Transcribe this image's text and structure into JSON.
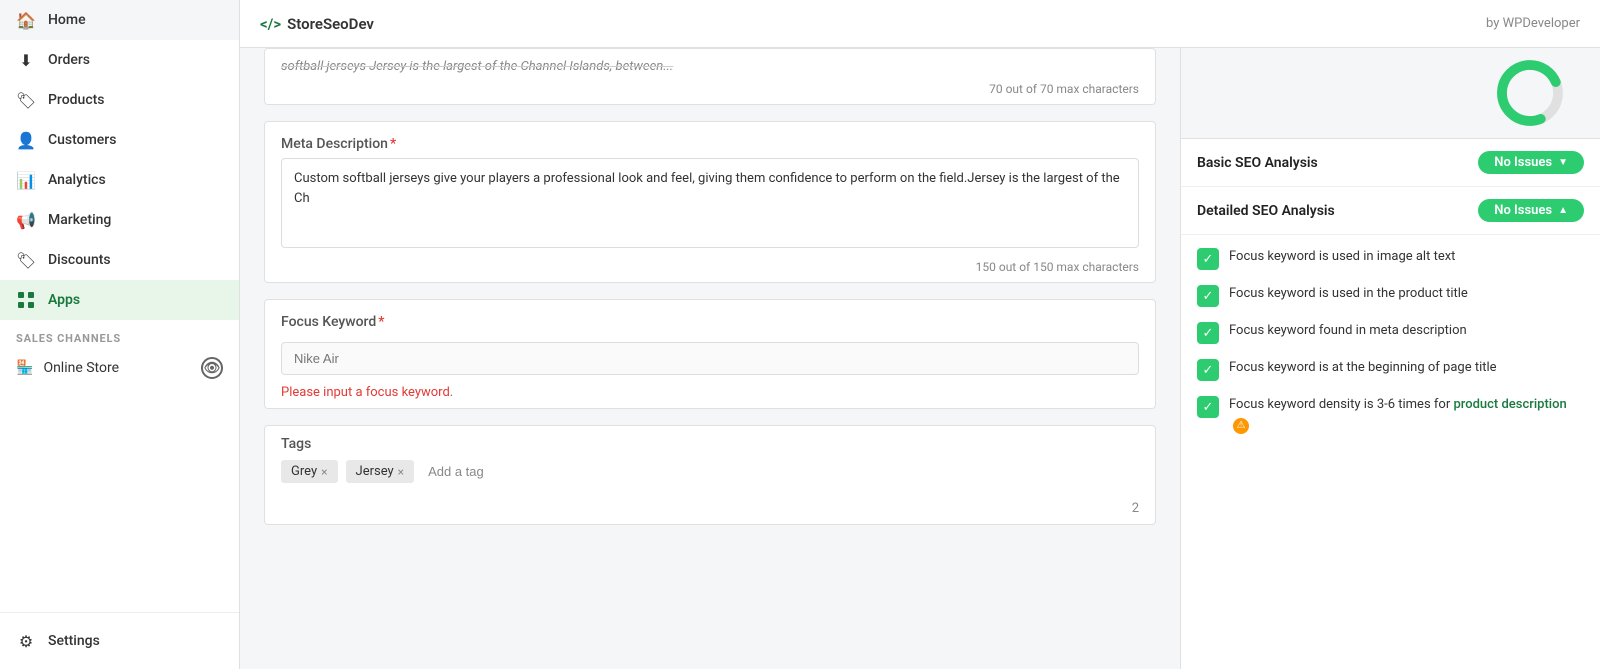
{
  "topbar": {
    "brand": "</> StoreSeoDev",
    "brand_code": "</>",
    "brand_name": "StoreSeoDev",
    "by": "by WPDeveloper"
  },
  "sidebar": {
    "nav_items": [
      {
        "id": "home",
        "label": "Home",
        "icon": "🏠"
      },
      {
        "id": "orders",
        "label": "Orders",
        "icon": "⬇"
      },
      {
        "id": "products",
        "label": "Products",
        "icon": "🏷"
      },
      {
        "id": "customers",
        "label": "Customers",
        "icon": "👤"
      },
      {
        "id": "analytics",
        "label": "Analytics",
        "icon": "📊"
      },
      {
        "id": "marketing",
        "label": "Marketing",
        "icon": "📢"
      },
      {
        "id": "discounts",
        "label": "Discounts",
        "icon": "🏷"
      },
      {
        "id": "apps",
        "label": "Apps",
        "icon": "⚙",
        "active": true
      }
    ],
    "sales_channels_label": "SALES CHANNELS",
    "sales_channels": [
      {
        "id": "online-store",
        "label": "Online Store"
      }
    ],
    "settings_label": "Settings"
  },
  "main": {
    "truncated_text": "softball jerseys Jersey is the largest of the Channel Islands, between...",
    "char_count_title": "70 out of 70 max characters",
    "meta_desc_label": "Meta Description",
    "meta_desc_value": "Custom softball jerseys give your players a professional look and feel, giving them confidence to perform on the field.Jersey is the largest of the Ch",
    "meta_char_count": "150 out of 150 max characters",
    "focus_keyword_label": "Focus Keyword",
    "focus_keyword_placeholder": "Nike Air",
    "focus_keyword_error": "Please input a focus keyword.",
    "tags_label": "Tags",
    "tags": [
      {
        "label": "Grey",
        "id": "grey"
      },
      {
        "label": "Jersey",
        "id": "jersey"
      }
    ],
    "add_tag_label": "Add a tag",
    "page_num": "2"
  },
  "seo_panel": {
    "basic_seo_label": "Basic SEO Analysis",
    "basic_seo_status": "No Issues",
    "basic_arrow": "▼",
    "detailed_seo_label": "Detailed SEO Analysis",
    "detailed_seo_status": "No Issues",
    "detailed_arrow": "▲",
    "checks": [
      {
        "id": "alt-text",
        "text": "Focus keyword is used in image alt text",
        "has_warning": false
      },
      {
        "id": "product-title",
        "text": "Focus keyword is used in the product title",
        "has_warning": false
      },
      {
        "id": "meta-desc",
        "text": "Focus keyword found in meta description",
        "has_warning": false
      },
      {
        "id": "page-title",
        "text": "Focus keyword is at the beginning of page title",
        "has_warning": false
      },
      {
        "id": "density",
        "text": "Focus keyword density is 3-6 times for product description",
        "has_warning": true,
        "highlight_word": "product description"
      }
    ]
  }
}
